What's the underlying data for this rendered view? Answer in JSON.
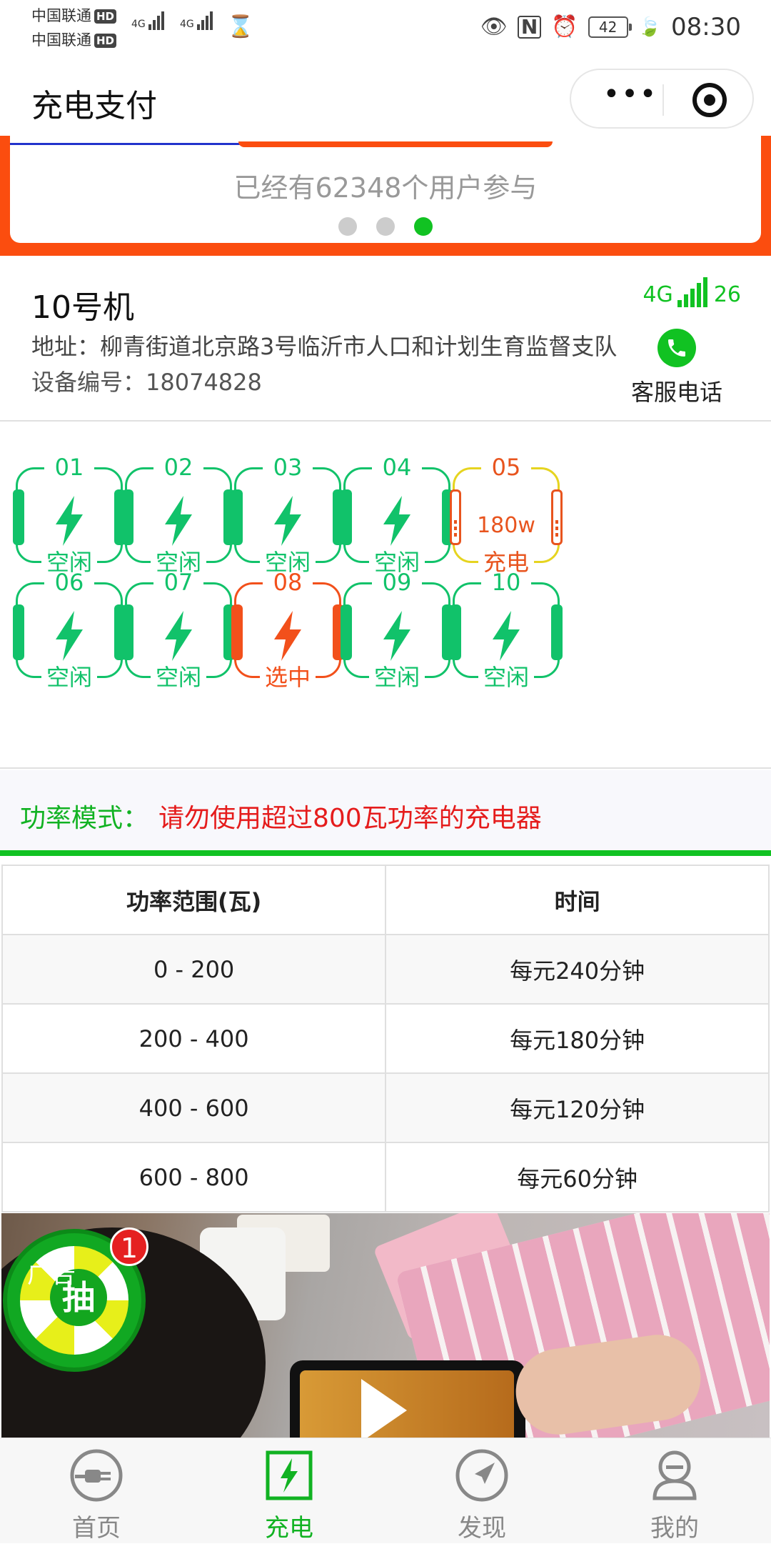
{
  "status_bar": {
    "carrier_1": "中国联通",
    "carrier_2": "中国联通",
    "hd_badge": "HD",
    "network": "4G",
    "battery": "42",
    "time": "08:30",
    "icons": [
      "eye-icon",
      "nfc-icon",
      "alarm-icon",
      "battery-icon",
      "leaf-icon"
    ]
  },
  "header": {
    "title": "充电支付",
    "more_label": "•••"
  },
  "banner": {
    "text": "已经有62348个用户参与",
    "dots": 3,
    "active_dot": 3
  },
  "machine": {
    "name": "10号机",
    "address": "地址：柳青街道北京路3号临沂市人口和计划生育监督支队",
    "device_no": "设备编号：18074828",
    "signal_type": "4G",
    "signal_value": "26",
    "service_label": "客服电话"
  },
  "ports": [
    {
      "num": "01",
      "state": "空闲"
    },
    {
      "num": "02",
      "state": "空闲"
    },
    {
      "num": "03",
      "state": "空闲"
    },
    {
      "num": "04",
      "state": "空闲"
    },
    {
      "num": "05",
      "state": "充电",
      "watt": "180w"
    },
    {
      "num": "06",
      "state": "空闲"
    },
    {
      "num": "07",
      "state": "空闲"
    },
    {
      "num": "08",
      "state": "选中"
    },
    {
      "num": "09",
      "state": "空闲"
    },
    {
      "num": "10",
      "state": "空闲"
    }
  ],
  "power_mode": {
    "label": "功率模式：",
    "message": "请勿使用超过800瓦功率的充电器"
  },
  "rate_table": {
    "headers": [
      "功率范围(瓦)",
      "时间"
    ],
    "rows": [
      [
        "0 - 200",
        "每元240分钟"
      ],
      [
        "200 - 400",
        "每元180分钟"
      ],
      [
        "400 - 600",
        "每元120分钟"
      ],
      [
        "600 - 800",
        "每元60分钟"
      ]
    ]
  },
  "ad": {
    "label": "广告",
    "lottery_char": "抽",
    "badge_count": "1"
  },
  "tabbar": {
    "items": [
      {
        "label": "首页",
        "icon": "plug-icon"
      },
      {
        "label": "充电",
        "icon": "charge-icon"
      },
      {
        "label": "发现",
        "icon": "compass-icon"
      },
      {
        "label": "我的",
        "icon": "user-icon"
      }
    ]
  },
  "colors": {
    "green": "#11c222",
    "orange": "#fb4d0f",
    "red_warning": "#e51c1c"
  }
}
